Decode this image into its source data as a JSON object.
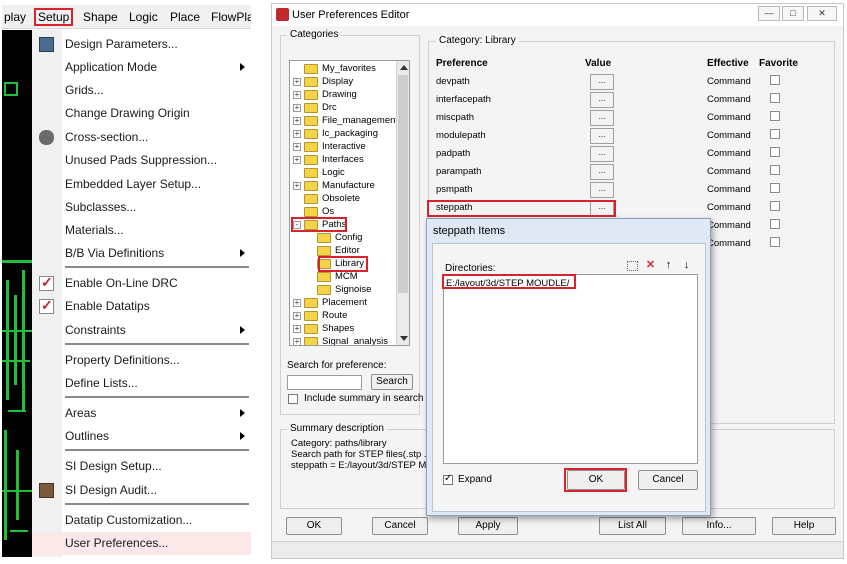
{
  "setup_menu": {
    "menubar": [
      "play",
      "Setup",
      "Shape",
      "Logic",
      "Place",
      "FlowPla"
    ],
    "items": [
      {
        "label": "Design Parameters...",
        "icon": "design-params-icon",
        "submenu": false
      },
      {
        "label": "Application Mode",
        "submenu": true
      },
      {
        "label": "Grids...",
        "submenu": false
      },
      {
        "label": "Change Drawing Origin",
        "submenu": false
      },
      {
        "label": "Cross-section...",
        "icon": "cross-section-icon",
        "submenu": false
      },
      {
        "label": "Unused Pads Suppression...",
        "submenu": false
      },
      {
        "label": "Embedded Layer Setup...",
        "submenu": false
      },
      {
        "label": "Subclasses...",
        "submenu": false
      },
      {
        "label": "Materials...",
        "submenu": false
      },
      {
        "label": "B/B Via Definitions",
        "submenu": true
      },
      {
        "label": "Enable On-Line DRC",
        "checked": true
      },
      {
        "label": "Enable Datatips",
        "checked": true
      },
      {
        "label": "Constraints",
        "submenu": true
      },
      {
        "label": "Property Definitions...",
        "submenu": false
      },
      {
        "label": "Define Lists...",
        "submenu": false
      },
      {
        "label": "Areas",
        "submenu": true
      },
      {
        "label": "Outlines",
        "submenu": true
      },
      {
        "label": "SI Design Setup...",
        "submenu": false
      },
      {
        "label": "SI Design Audit...",
        "icon": "si-audit-icon",
        "submenu": false
      },
      {
        "label": "Datatip Customization...",
        "submenu": false
      },
      {
        "label": "User Preferences...",
        "submenu": false,
        "highlighted": true
      }
    ]
  },
  "editor": {
    "title": "User Preferences Editor",
    "categories_label": "Categories",
    "category_caption": "Category:  Library",
    "tree": [
      {
        "label": "My_favorites",
        "expander": ""
      },
      {
        "label": "Display",
        "expander": "+"
      },
      {
        "label": "Drawing",
        "expander": "+"
      },
      {
        "label": "Drc",
        "expander": "+"
      },
      {
        "label": "File_management",
        "expander": "+"
      },
      {
        "label": "Ic_packaging",
        "expander": "+"
      },
      {
        "label": "Interactive",
        "expander": "+"
      },
      {
        "label": "Interfaces",
        "expander": "+"
      },
      {
        "label": "Logic",
        "expander": ""
      },
      {
        "label": "Manufacture",
        "expander": "+"
      },
      {
        "label": "Obsolete",
        "expander": ""
      },
      {
        "label": "Os",
        "expander": ""
      },
      {
        "label": "Paths",
        "expander": "-"
      },
      {
        "label": "Config",
        "expander": ""
      },
      {
        "label": "Editor",
        "expander": ""
      },
      {
        "label": "Library",
        "expander": ""
      },
      {
        "label": "MCM",
        "expander": ""
      },
      {
        "label": "Signoise",
        "expander": ""
      },
      {
        "label": "Placement",
        "expander": "+"
      },
      {
        "label": "Route",
        "expander": "+"
      },
      {
        "label": "Shapes",
        "expander": "+"
      },
      {
        "label": "Signal_analysis",
        "expander": "+"
      }
    ],
    "columns": {
      "preference": "Preference",
      "value": "Value",
      "effective": "Effective",
      "favorite": "Favorite"
    },
    "preferences": [
      {
        "name": "devpath",
        "value": "...",
        "effective": "Command"
      },
      {
        "name": "interfacepath",
        "value": "...",
        "effective": "Command"
      },
      {
        "name": "miscpath",
        "value": "...",
        "effective": "Command"
      },
      {
        "name": "modulepath",
        "value": "...",
        "effective": "Command"
      },
      {
        "name": "padpath",
        "value": "...",
        "effective": "Command"
      },
      {
        "name": "parampath",
        "value": "...",
        "effective": "Command"
      },
      {
        "name": "psmpath",
        "value": "...",
        "effective": "Command"
      },
      {
        "name": "steppath",
        "value": "...",
        "effective": "Command"
      },
      {
        "name": "",
        "value": "",
        "effective": "Command"
      },
      {
        "name": "",
        "value": "",
        "effective": "Command"
      }
    ],
    "search_label": "Search for preference:",
    "search_value": "",
    "search_button": "Search",
    "include_summary": "Include summary in search",
    "summary_label": "Summary description",
    "summary_lines": [
      "Category: paths/library",
      "Search path for STEP files(.stp .ste",
      "steppath = E:/layout/3d/STEP MO"
    ],
    "buttons": {
      "ok": "OK",
      "cancel": "Cancel",
      "apply": "Apply",
      "list_all": "List All",
      "info": "Info...",
      "help": "Help"
    }
  },
  "steppath_dialog": {
    "title": "steppath Items",
    "directories_label": "Directories:",
    "directory_value": "E:/layout/3d/STEP MOUDLE/",
    "expand_label": "Expand",
    "expand_checked": true,
    "ok": "OK",
    "cancel": "Cancel"
  },
  "colors": {
    "highlight": "#d9232a",
    "folder": "#f3d34a",
    "canvas_green": "#1fbf3a"
  }
}
